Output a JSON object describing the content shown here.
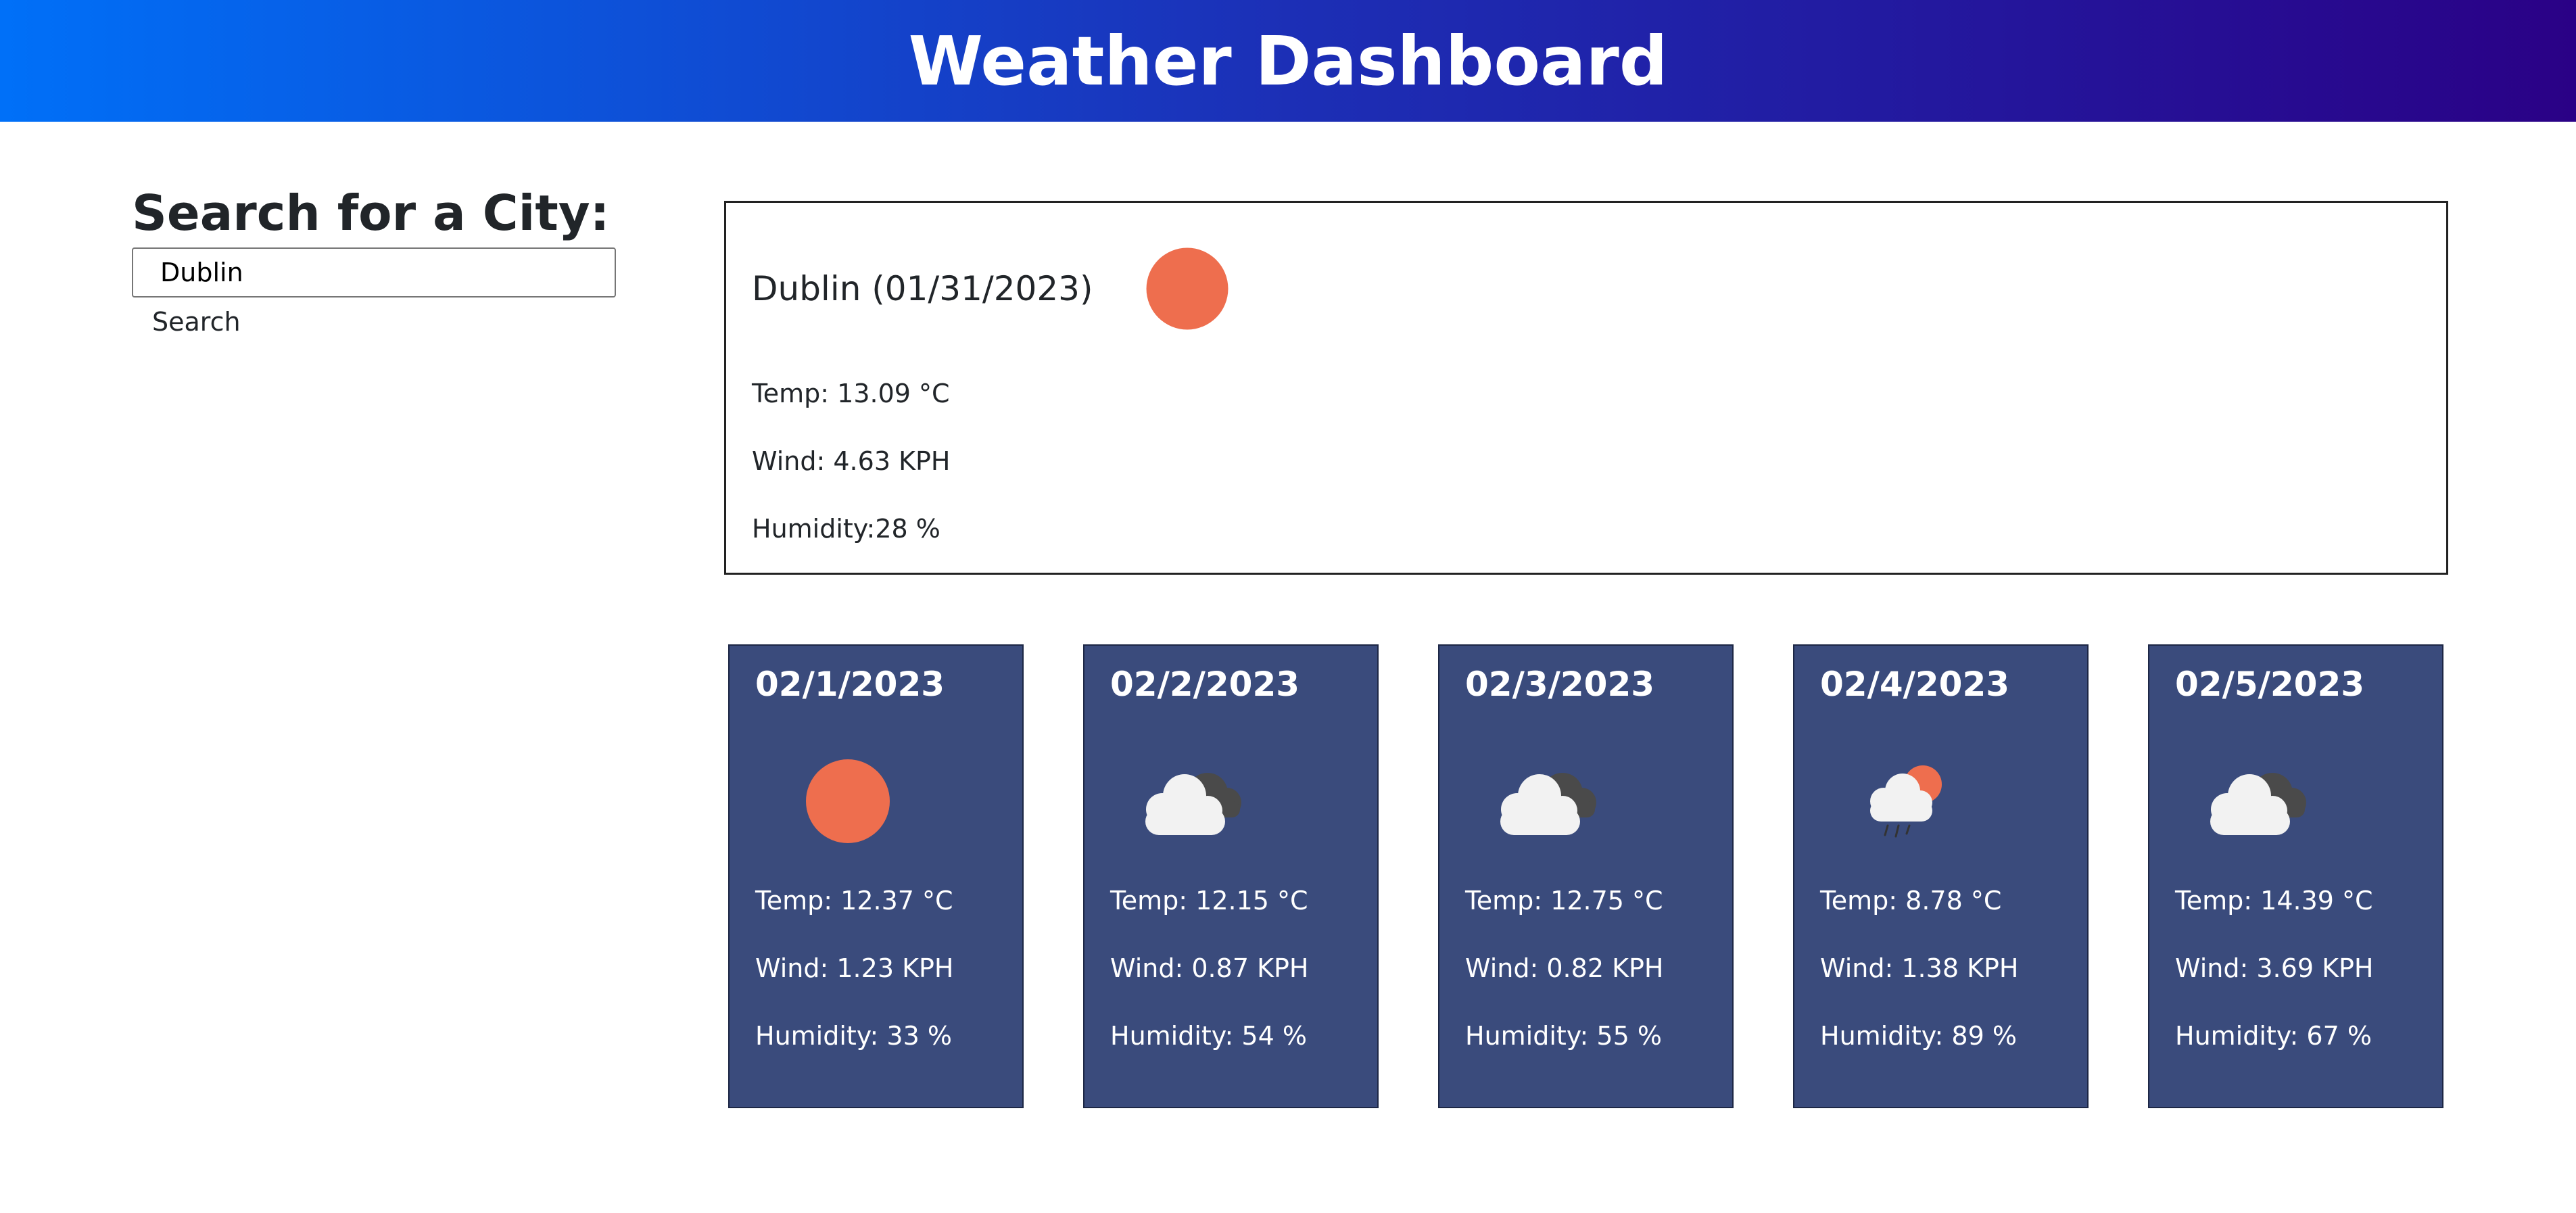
{
  "header": {
    "title": "Weather Dashboard"
  },
  "search": {
    "title": "Search for a City:",
    "input_value": "Dublin",
    "button_label": "Search"
  },
  "current": {
    "heading": "Dublin (01/31/2023)",
    "icon": "sun-icon",
    "temp": "Temp: 13.09 °C",
    "wind": "Wind: 4.63 KPH",
    "humidity": "Humidity:28 %"
  },
  "forecast": [
    {
      "date": "02/1/2023",
      "icon": "sun-icon",
      "temp": "Temp: 12.37 °C",
      "wind": "Wind: 1.23 KPH",
      "humidity": "Humidity: 33 %"
    },
    {
      "date": "02/2/2023",
      "icon": "clouds-icon",
      "temp": "Temp: 12.15 °C",
      "wind": "Wind: 0.87 KPH",
      "humidity": "Humidity: 54 %"
    },
    {
      "date": "02/3/2023",
      "icon": "clouds-icon",
      "temp": "Temp: 12.75 °C",
      "wind": "Wind: 0.82 KPH",
      "humidity": "Humidity: 55 %"
    },
    {
      "date": "02/4/2023",
      "icon": "sun-cloud-rain-icon",
      "temp": "Temp: 8.78 °C",
      "wind": "Wind: 1.38 KPH",
      "humidity": "Humidity: 89 %"
    },
    {
      "date": "02/5/2023",
      "icon": "clouds-icon",
      "temp": "Temp: 14.39 °C",
      "wind": "Wind: 3.69 KPH",
      "humidity": "Humidity: 67 %"
    }
  ],
  "colors": {
    "header_start": "#0070f8",
    "header_end": "#2a0186",
    "sun": "#ee6e4e",
    "forecast_bg": "#3a4b7c"
  }
}
